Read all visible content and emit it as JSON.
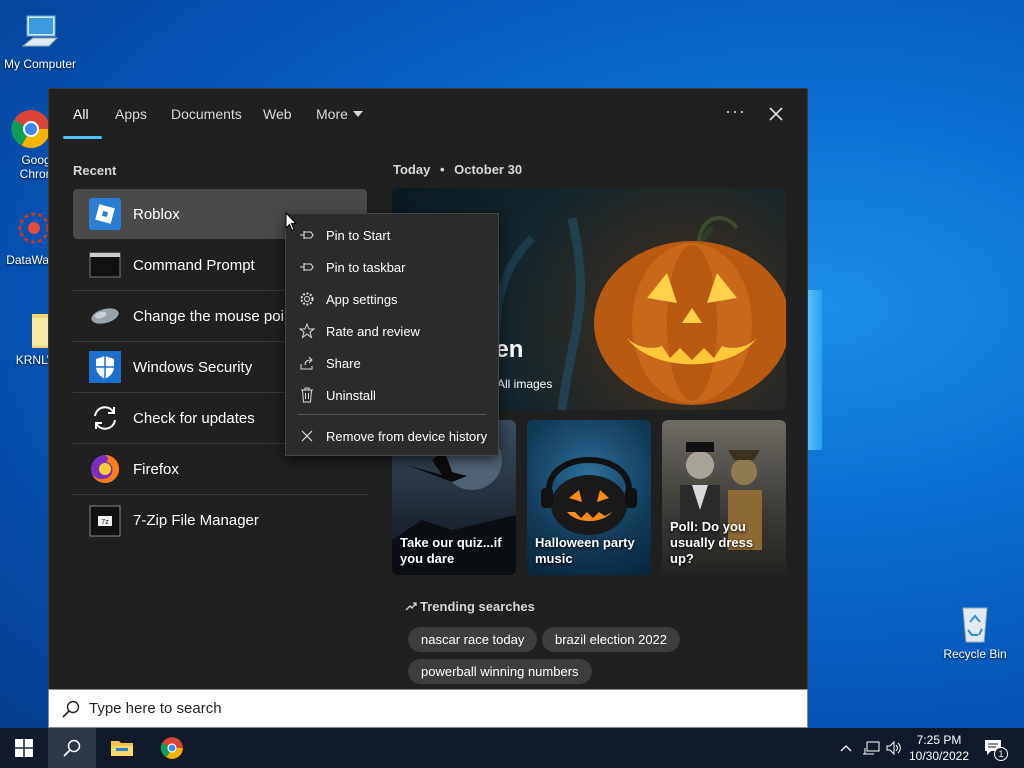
{
  "desktop": {
    "icons": [
      {
        "label": "My Computer"
      },
      {
        "label": "Goog Chron"
      },
      {
        "label": "DataWag"
      },
      {
        "label": "KRNLW"
      },
      {
        "label": "Recycle Bin"
      }
    ]
  },
  "search_panel": {
    "tabs": [
      {
        "label": "All",
        "active": true
      },
      {
        "label": "Apps"
      },
      {
        "label": "Documents"
      },
      {
        "label": "Web"
      },
      {
        "label": "More"
      }
    ],
    "recent_heading": "Recent",
    "recent_items": [
      {
        "label": "Roblox",
        "icon": "roblox-icon",
        "selected": true
      },
      {
        "label": "Command Prompt",
        "icon": "command-prompt-icon"
      },
      {
        "label": "Change the mouse pointer",
        "icon": "mouse-icon"
      },
      {
        "label": "Windows Security",
        "icon": "shield-icon"
      },
      {
        "label": "Check for updates",
        "icon": "sync-icon"
      },
      {
        "label": "Firefox",
        "icon": "firefox-icon"
      },
      {
        "label": "7-Zip File Manager",
        "icon": "7zip-icon"
      }
    ],
    "today": {
      "label": "Today",
      "separator": "•",
      "date": "October 30"
    },
    "hero": {
      "title": "een",
      "subtitle": "All images"
    },
    "cards": [
      {
        "caption": "Take our quiz...if you dare"
      },
      {
        "caption": "Halloween party music"
      },
      {
        "caption": "Poll: Do you usually dress up?"
      }
    ],
    "trending_heading": "Trending searches",
    "trending": [
      {
        "label": "nascar race today"
      },
      {
        "label": "brazil election 2022"
      },
      {
        "label": "powerball winning numbers"
      }
    ]
  },
  "context_menu": {
    "items": [
      {
        "label": "Pin to Start",
        "icon": "pin-icon"
      },
      {
        "label": "Pin to taskbar",
        "icon": "pin-icon"
      },
      {
        "label": "App settings",
        "icon": "gear-icon"
      },
      {
        "label": "Rate and review",
        "icon": "star-icon"
      },
      {
        "label": "Share",
        "icon": "share-icon"
      },
      {
        "label": "Uninstall",
        "icon": "trash-icon"
      },
      {
        "label": "Remove from device history",
        "icon": "close-icon"
      }
    ]
  },
  "searchbar": {
    "placeholder": "Type here to search"
  },
  "taskbar": {
    "time": "7:25 PM",
    "date": "10/30/2022",
    "notifications_count": "1"
  }
}
